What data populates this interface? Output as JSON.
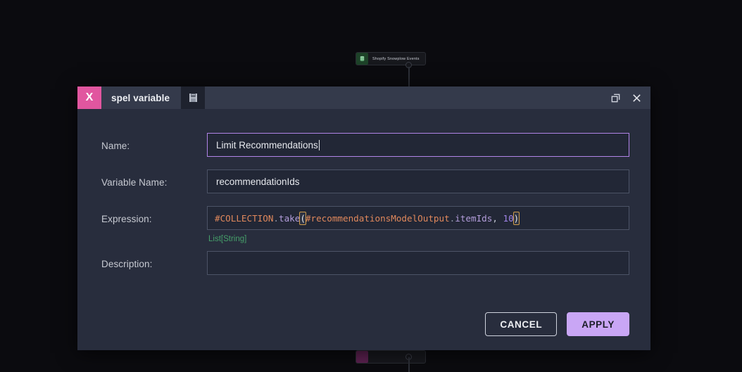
{
  "canvas": {
    "nodes": [
      {
        "label": "Shopify Snowplow Events",
        "icon": "database-icon",
        "color": "#1d4228"
      },
      {
        "label": "",
        "icon": "node-icon",
        "color": "#5c2150"
      }
    ]
  },
  "dialog": {
    "logo": "X",
    "title": "spel variable",
    "tab_icon": "save-icon",
    "maximize_icon": "maximize-icon",
    "close_icon": "close-icon",
    "fields": {
      "name": {
        "label": "Name:",
        "value": "Limit Recommendations",
        "placeholder": ""
      },
      "variable_name": {
        "label": "Variable Name:",
        "value": "recommendationIds",
        "placeholder": ""
      },
      "expression": {
        "label": "Expression:",
        "value": "#COLLECTION.take(#recommendationsModelOutput.itemIds, 10)",
        "tokens": {
          "collection": "#COLLECTION",
          "dot1": ".",
          "take": "take",
          "open_paren": "(",
          "arg_var": "#recommendationsModelOutput",
          "dot2": ".",
          "arg_prop": "itemIds",
          "comma": ", ",
          "number": "10",
          "close_paren": ")"
        },
        "type_hint": "List[String]"
      },
      "description": {
        "label": "Description:",
        "value": "",
        "placeholder": ""
      }
    },
    "buttons": {
      "cancel": "CANCEL",
      "apply": "APPLY"
    }
  },
  "colors": {
    "accent_pink": "#e1569f",
    "accent_purple": "#c9a6f5",
    "focus_border": "#b184e8",
    "type_hint_green": "#46a06a",
    "bracket_match": "#cf9b4a",
    "dialog_bg": "#282d3d",
    "titlebar_bg": "#343a4b",
    "field_bg": "#222736",
    "canvas_bg": "#0b0b0f"
  }
}
